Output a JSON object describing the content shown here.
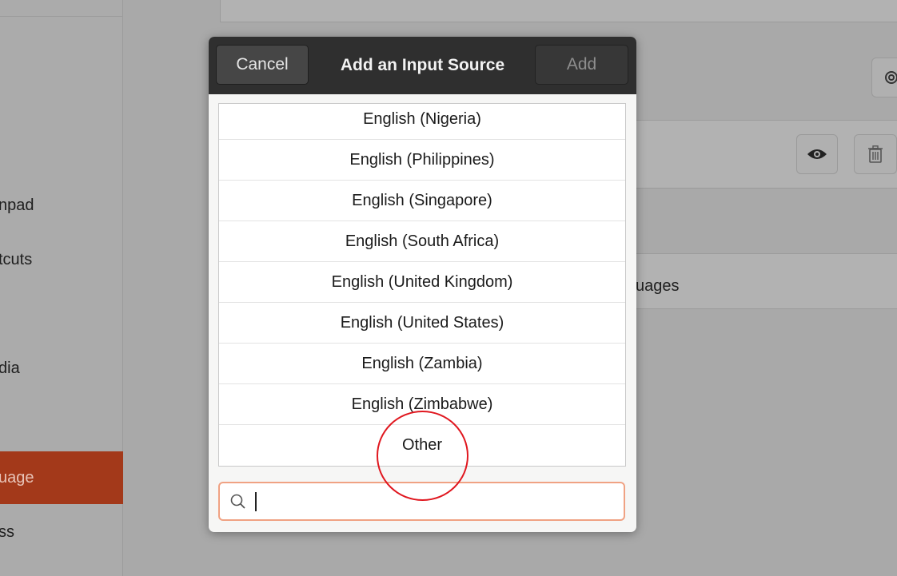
{
  "sidebar": {
    "items": [
      {
        "label": "Touchpad"
      },
      {
        "label": "Keyboard Shortcuts"
      },
      {
        "label": "Removable Media"
      },
      {
        "label": "Region & Language"
      },
      {
        "label": "Accessibility"
      }
    ],
    "visible_fragments": [
      "npad",
      "tcuts",
      "dia",
      "uage",
      "ss"
    ]
  },
  "main": {
    "languages_label_fragment": "uages"
  },
  "dialog": {
    "title": "Add an Input Source",
    "cancel_label": "Cancel",
    "add_label": "Add",
    "items": [
      {
        "label": "English (Nigeria)"
      },
      {
        "label": "English (Philippines)"
      },
      {
        "label": "English (Singapore)"
      },
      {
        "label": "English (South Africa)"
      },
      {
        "label": "English (United Kingdom)"
      },
      {
        "label": "English (United States)"
      },
      {
        "label": "English (Zambia)"
      },
      {
        "label": "English (Zimbabwe)"
      },
      {
        "label": "Other"
      }
    ],
    "search": {
      "value": "",
      "icon": "search-icon"
    }
  },
  "colors": {
    "accent": "#a3391a",
    "headerbar": "#2f2f2f",
    "search_focus": "#f0a283",
    "highlight_circle": "#e0171f"
  }
}
